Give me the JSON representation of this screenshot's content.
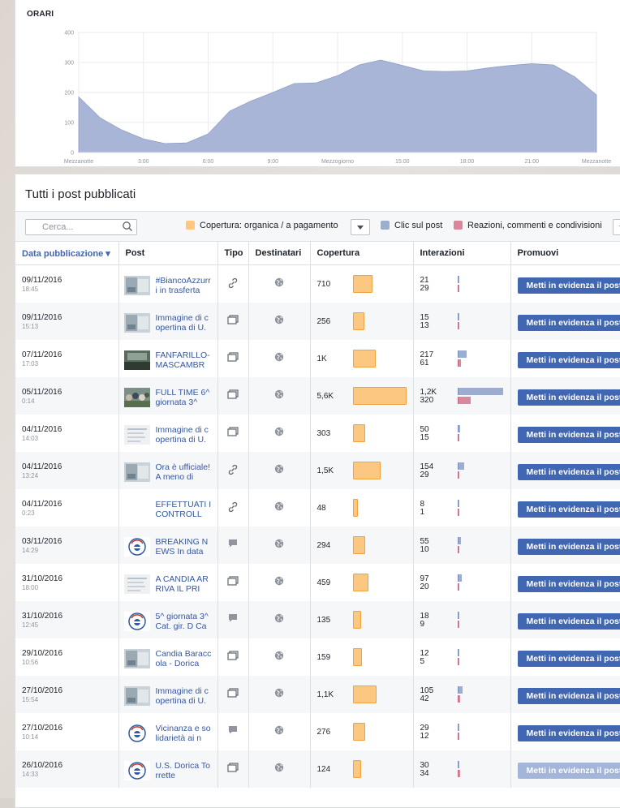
{
  "hours_chart": {
    "title": "ORARI",
    "yticks": [
      "400",
      "300",
      "200",
      "100",
      "0"
    ],
    "xticks": [
      "Mezzanotte",
      "3:00",
      "6:00",
      "9:00",
      "Mezzogiorno",
      "15:00",
      "18:00",
      "21:00",
      "Mezzanotte"
    ]
  },
  "chart_data": {
    "type": "area",
    "title": "ORARI",
    "xlabel": "",
    "ylabel": "",
    "ylim": [
      0,
      400
    ],
    "x": [
      "0:00",
      "1:00",
      "2:00",
      "3:00",
      "4:00",
      "5:00",
      "6:00",
      "7:00",
      "8:00",
      "9:00",
      "10:00",
      "11:00",
      "12:00",
      "13:00",
      "14:00",
      "15:00",
      "16:00",
      "17:00",
      "18:00",
      "19:00",
      "20:00",
      "21:00",
      "22:00",
      "23:00",
      "24:00"
    ],
    "values": [
      185,
      115,
      75,
      45,
      30,
      32,
      62,
      138,
      172,
      200,
      230,
      232,
      256,
      292,
      308,
      290,
      272,
      270,
      272,
      282,
      290,
      296,
      292,
      252,
      192
    ],
    "grid": true,
    "color": "#a8b5d6"
  },
  "posts": {
    "title": "Tutti i post pubblicati",
    "search_placeholder": "Cerca...",
    "legend": {
      "reach": "Copertura: organica / a pagamento",
      "clicks": "Clic sul post",
      "reactions": "Reazioni, commenti e condivisioni"
    },
    "colors": {
      "reach": "#fcc881",
      "clicks": "#9cadd0",
      "reactions": "#d8879c",
      "button": "#4267b2"
    },
    "columns": [
      "Data pubblicazione ▾",
      "Post",
      "Tipo",
      "Destinatari",
      "Copertura",
      "Interazioni",
      "Promuovi"
    ],
    "promote_label": "Metti in evidenza il post",
    "rows": [
      {
        "date": "09/11/2016",
        "time": "18:45",
        "text": "#BiancoAzzurri in trasferta",
        "type": "link",
        "reach": "710",
        "reach_val": 710,
        "clicks": "21",
        "reactions": "29",
        "clicks_val": 21,
        "reactions_val": 29,
        "thumb": "photo"
      },
      {
        "date": "09/11/2016",
        "time": "15:13",
        "text": "Immagine di copertina di U.",
        "type": "photo",
        "reach": "256",
        "reach_val": 256,
        "clicks": "15",
        "reactions": "13",
        "clicks_val": 15,
        "reactions_val": 13,
        "thumb": "photo"
      },
      {
        "date": "07/11/2016",
        "time": "17:03",
        "text": "FANFARILLO-MASCAMBR",
        "type": "photo",
        "reach": "1K",
        "reach_val": 1000,
        "clicks": "217",
        "reactions": "61",
        "clicks_val": 217,
        "reactions_val": 61,
        "thumb": "dark"
      },
      {
        "date": "05/11/2016",
        "time": "0:14",
        "text": "FULL TIME 6^ giornata 3^",
        "type": "photo",
        "reach": "5,6K",
        "reach_val": 5600,
        "clicks": "1,2K",
        "reactions": "320",
        "clicks_val": 1200,
        "reactions_val": 320,
        "thumb": "crowd"
      },
      {
        "date": "04/11/2016",
        "time": "14:03",
        "text": "Immagine di copertina di U.",
        "type": "photo",
        "reach": "303",
        "reach_val": 303,
        "clicks": "50",
        "reactions": "15",
        "clicks_val": 50,
        "reactions_val": 15,
        "thumb": "doc"
      },
      {
        "date": "04/11/2016",
        "time": "13:24",
        "text": "Ora è ufficiale! A meno di",
        "type": "link",
        "reach": "1,5K",
        "reach_val": 1500,
        "clicks": "154",
        "reactions": "29",
        "clicks_val": 154,
        "reactions_val": 29,
        "thumb": "photo"
      },
      {
        "date": "04/11/2016",
        "time": "0:23",
        "text": "EFFETTUATI I CONTROLL",
        "type": "link",
        "reach": "48",
        "reach_val": 48,
        "clicks": "8",
        "reactions": "1",
        "clicks_val": 8,
        "reactions_val": 1,
        "thumb": "blank"
      },
      {
        "date": "03/11/2016",
        "time": "14:29",
        "text": "BREAKING NEWS In data",
        "type": "status",
        "reach": "294",
        "reach_val": 294,
        "clicks": "55",
        "reactions": "10",
        "clicks_val": 55,
        "reactions_val": 10,
        "thumb": "logo"
      },
      {
        "date": "31/10/2016",
        "time": "18:00",
        "text": "A CANDIA ARRIVA IL PRI",
        "type": "photo",
        "reach": "459",
        "reach_val": 459,
        "clicks": "97",
        "reactions": "20",
        "clicks_val": 97,
        "reactions_val": 20,
        "thumb": "doc"
      },
      {
        "date": "31/10/2016",
        "time": "12:45",
        "text": "5^ giornata 3^ Cat. gir. D Ca",
        "type": "status",
        "reach": "135",
        "reach_val": 135,
        "clicks": "18",
        "reactions": "9",
        "clicks_val": 18,
        "reactions_val": 9,
        "thumb": "logo"
      },
      {
        "date": "29/10/2016",
        "time": "10:56",
        "text": "Candia Baraccola - Dorica",
        "type": "photo",
        "reach": "159",
        "reach_val": 159,
        "clicks": "12",
        "reactions": "5",
        "clicks_val": 12,
        "reactions_val": 5,
        "thumb": "photo"
      },
      {
        "date": "27/10/2016",
        "time": "15:54",
        "text": "Immagine di copertina di U.",
        "type": "photo",
        "reach": "1,1K",
        "reach_val": 1100,
        "clicks": "105",
        "reactions": "42",
        "clicks_val": 105,
        "reactions_val": 42,
        "thumb": "photo"
      },
      {
        "date": "27/10/2016",
        "time": "10:14",
        "text": "Vicinanza e solidarietà ai n",
        "type": "status",
        "reach": "276",
        "reach_val": 276,
        "clicks": "29",
        "reactions": "12",
        "clicks_val": 29,
        "reactions_val": 12,
        "thumb": "logo"
      },
      {
        "date": "26/10/2016",
        "time": "14:33",
        "text": "U.S. Dorica Torrette",
        "type": "photo",
        "reach": "124",
        "reach_val": 124,
        "clicks": "30",
        "reactions": "34",
        "clicks_val": 30,
        "reactions_val": 34,
        "thumb": "logo",
        "disabled": true
      }
    ]
  }
}
